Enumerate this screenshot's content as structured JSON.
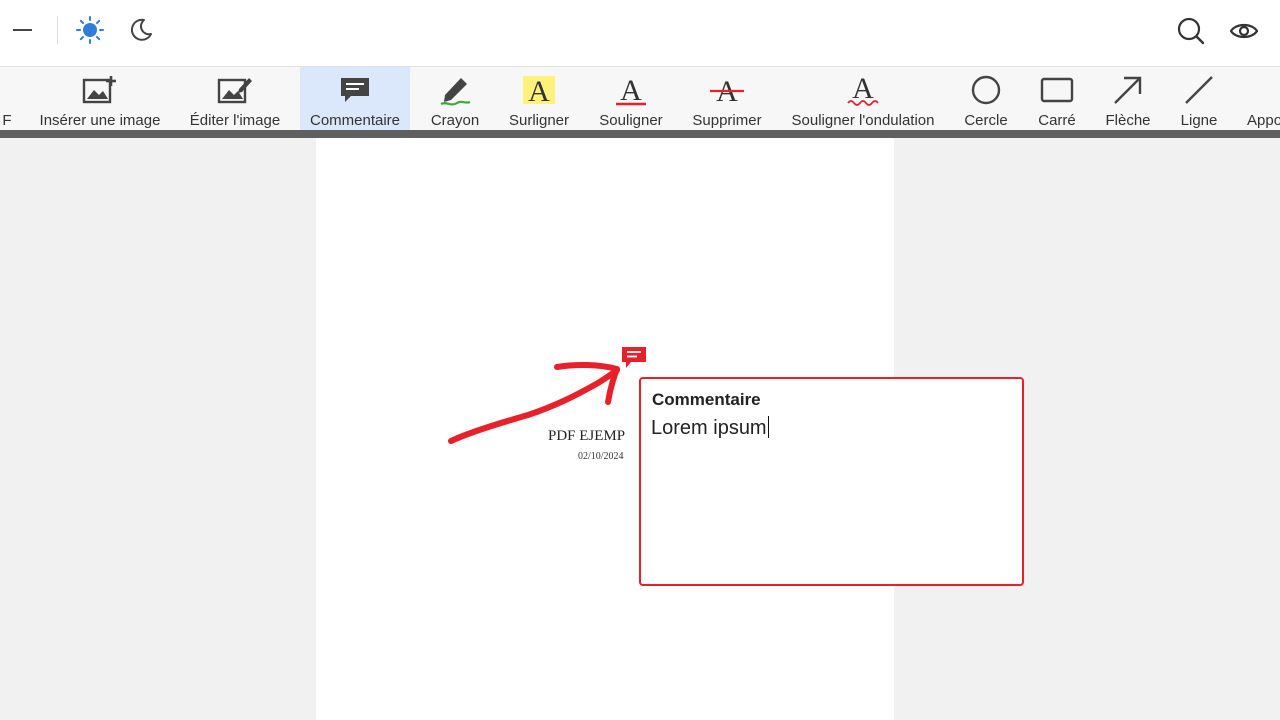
{
  "topbar": {
    "minimize_icon": "minus-icon",
    "light_theme_icon": "sun-icon",
    "dark_theme_icon": "moon-icon",
    "search_icon": "search-icon",
    "preview_icon": "eye-icon"
  },
  "toolbar": {
    "partial_left_label": "F",
    "items": [
      {
        "label": "Insérer une image",
        "icon": "insert-image-icon"
      },
      {
        "label": "Éditer l'image",
        "icon": "edit-image-icon"
      },
      {
        "label": "Commentaire",
        "icon": "comment-icon",
        "active": true
      },
      {
        "label": "Crayon",
        "icon": "pencil-icon"
      },
      {
        "label": "Surligner",
        "icon": "highlight-icon"
      },
      {
        "label": "Souligner",
        "icon": "underline-icon"
      },
      {
        "label": "Supprimer",
        "icon": "strikethrough-icon"
      },
      {
        "label": "Souligner l'ondulation",
        "icon": "squiggly-underline-icon"
      },
      {
        "label": "Cercle",
        "icon": "circle-icon"
      },
      {
        "label": "Carré",
        "icon": "square-icon"
      },
      {
        "label": "Flèche",
        "icon": "arrow-icon"
      },
      {
        "label": "Ligne",
        "icon": "line-icon"
      }
    ],
    "partial_right_label": "Appo"
  },
  "document": {
    "title_text": "PDF EJEMP",
    "date_text": "02/10/2024"
  },
  "comment": {
    "title": "Commentaire",
    "text": "Lorem ipsum"
  },
  "colors": {
    "accent_red": "#e8202a",
    "active_tool_bg": "#dbe8fb",
    "sun_blue": "#2f7fd8",
    "highlight_yellow": "#fff27a",
    "pencil_green": "#3caa3c"
  }
}
